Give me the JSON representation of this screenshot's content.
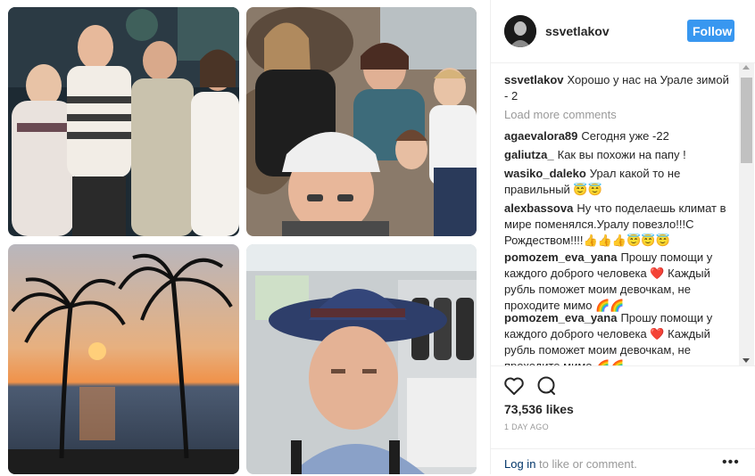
{
  "header": {
    "username": "ssvetlakov",
    "follow_label": "Follow"
  },
  "caption": {
    "user": "ssvetlakov",
    "text": "Хорошо у нас на Урале зимой - 2"
  },
  "load_more": "Load more comments",
  "comments": [
    {
      "user": "agaevalora89",
      "text": "Сегодня уже -22"
    },
    {
      "user": "galiutza_",
      "text": "Как вы похожи на папу !"
    },
    {
      "user": "wasiko_daleko",
      "text": "Урал какой то не правильный 😇😇"
    },
    {
      "user": "alexbassova",
      "text": "Ну что поделаешь климат в мире поменялся.Уралу повезло!!!С Рождеством!!!!👍👍👍😇😇😇"
    },
    {
      "user": "pomozem_eva_yana",
      "text": "Прошу помощи у каждого доброго человека ❤️ Каждый рубль поможет моим девочкам, не проходите мимо 🌈🌈"
    },
    {
      "user": "pomozem_eva_yana",
      "text": "Прошу помощи у каждого доброго человека ❤️ Каждый рубль поможет моим девочкам, не проходите мимо 🌈🌈"
    }
  ],
  "likes": "73,536 likes",
  "time_ago": "1 DAY AGO",
  "footer": {
    "login_label": "Log in",
    "rest": " to like or comment.",
    "more": "•••"
  },
  "icons": {
    "like": "heart-outline-icon",
    "comment": "comment-bubble-icon"
  },
  "colors": {
    "follow_bg": "#3897f0",
    "link": "#003569"
  }
}
